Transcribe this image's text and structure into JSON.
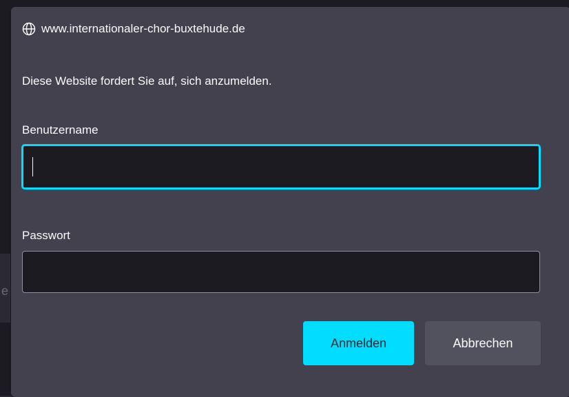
{
  "dialog": {
    "origin": "www.internationaler-chor-buxtehude.de",
    "origin_icon": "globe-icon",
    "message": "Diese Website fordert Sie auf, sich anzumelden.",
    "username": {
      "label": "Benutzername",
      "value": ""
    },
    "password": {
      "label": "Passwort",
      "value": ""
    },
    "buttons": {
      "submit": "Anmelden",
      "cancel": "Abbrechen"
    }
  },
  "colors": {
    "dialog_bg": "#42414d",
    "input_bg": "#1c1b22",
    "accent": "#00ddff",
    "text": "#fbfbfe",
    "secondary_button": "#52525e"
  }
}
